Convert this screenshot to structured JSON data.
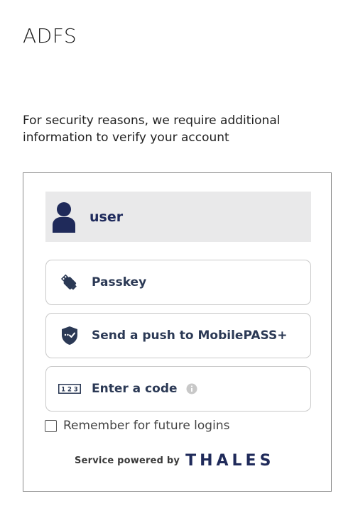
{
  "app": {
    "title": "ADFS"
  },
  "intro": {
    "message": "For security reasons, we require additional information to verify your account"
  },
  "user": {
    "name": "user",
    "icon": "user-icon"
  },
  "options": [
    {
      "label": "Passkey",
      "icon": "usb-key-icon"
    },
    {
      "label": "Send a push to MobilePASS+",
      "icon": "shield-check-icon"
    },
    {
      "label": "Enter a code",
      "icon": "code-123-icon",
      "info_icon": "info-icon"
    }
  ],
  "remember": {
    "label": "Remember for future logins",
    "checked": false
  },
  "footer": {
    "powered_by": "Service powered by",
    "brand": "THALES"
  },
  "colors": {
    "brand_navy": "#1f2a5a",
    "label_slate": "#2b3955",
    "user_row_bg": "#e9e9ea",
    "info_gray": "#c8c8c8"
  }
}
